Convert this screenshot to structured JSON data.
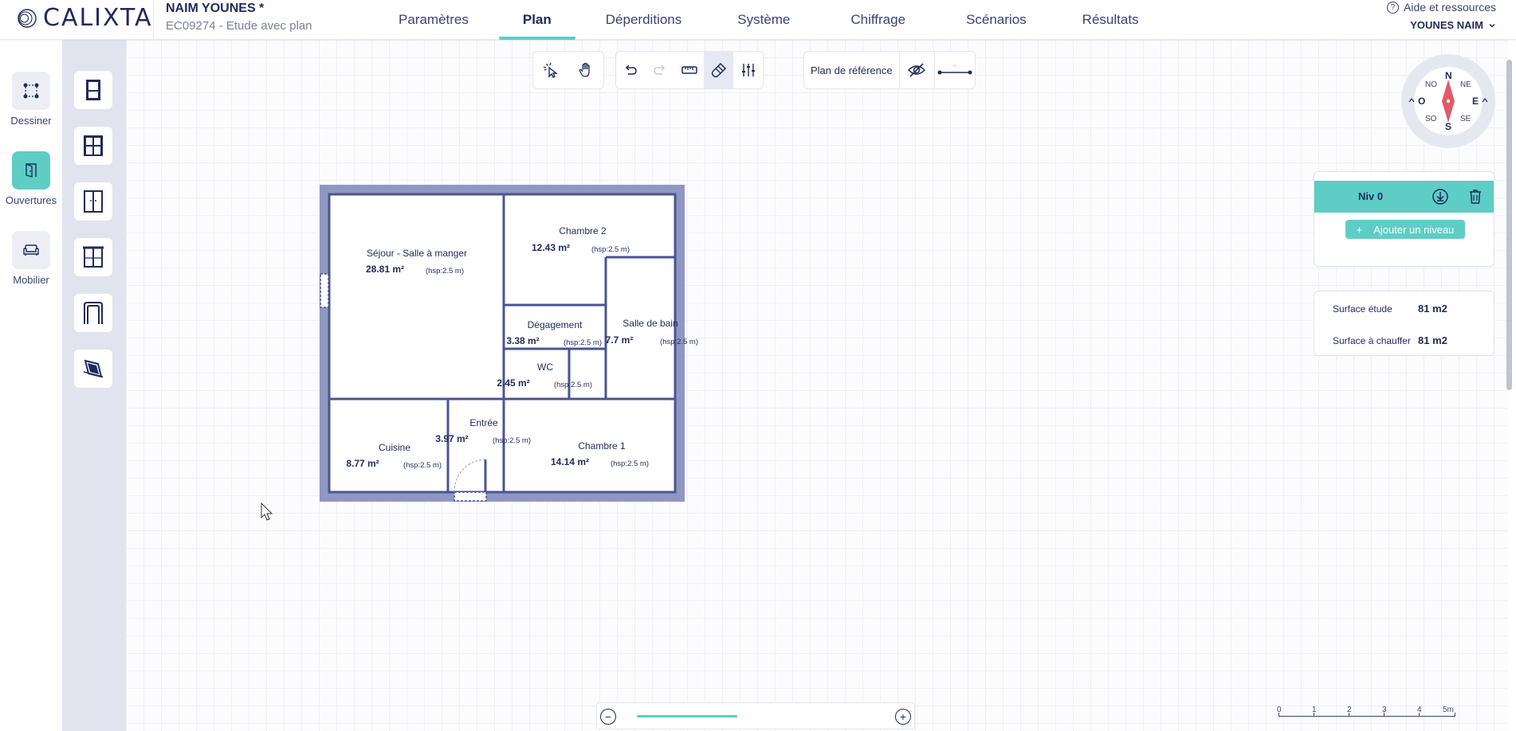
{
  "app": {
    "logo": "CALIXTA"
  },
  "project": {
    "name": "NAIM YOUNES *",
    "subtitle": "EC09274 - Etude avec plan"
  },
  "tabs": [
    {
      "label": "Paramètres"
    },
    {
      "label": "Plan",
      "active": true
    },
    {
      "label": "Déperditions"
    },
    {
      "label": "Système"
    },
    {
      "label": "Chiffrage"
    },
    {
      "label": "Scénarios"
    },
    {
      "label": "Résultats"
    }
  ],
  "header": {
    "help": "Aide et ressources",
    "user": "YOUNES NAIM"
  },
  "sidebar": {
    "items": [
      {
        "label": "Dessiner",
        "icon": "draw-shape-icon"
      },
      {
        "label": "Ouvertures",
        "icon": "door-icon",
        "active": true
      },
      {
        "label": "Mobilier",
        "icon": "sofa-icon"
      }
    ]
  },
  "tools": [
    "door-icon",
    "double-door-icon",
    "window-icon",
    "french-window-icon",
    "arch-opening-icon",
    "roof-window-icon"
  ],
  "toolbar": {
    "reference_plan": "Plan de référence",
    "scale_mark": "--"
  },
  "compass": {
    "N": "N",
    "S": "S",
    "E": "E",
    "O": "O",
    "NO": "NO",
    "NE": "NE",
    "SO": "SO",
    "SE": "SE"
  },
  "levels": {
    "current": "Niv 0",
    "add_label": "Ajouter un niveau",
    "add_symbol": "+"
  },
  "surfaces": [
    {
      "label": "Surface étude",
      "value": "81 m2"
    },
    {
      "label": "Surface à chauffer",
      "value": "81 m2"
    }
  ],
  "rooms": [
    {
      "name": "Séjour - Salle à manger",
      "area": "28.81 m²",
      "hsp": "(hsp:2.5 m)"
    },
    {
      "name": "Chambre 2",
      "area": "12.43 m²",
      "hsp": "(hsp:2.5 m)"
    },
    {
      "name": "Dégagement",
      "area": "3.38 m²",
      "hsp": "(hsp:2.5 m)"
    },
    {
      "name": "Salle de bain",
      "area": "7.7 m²",
      "hsp": "(hsp:2.5 m)"
    },
    {
      "name": "WC",
      "area": "2.45 m²",
      "hsp": "(hsp:2.5 m)"
    },
    {
      "name": "Entrée",
      "area": "3.97 m²",
      "hsp": "(hsp:2.5 m)"
    },
    {
      "name": "Cuisine",
      "area": "8.77 m²",
      "hsp": "(hsp:2.5 m)"
    },
    {
      "name": "Chambre 1",
      "area": "14.14 m²",
      "hsp": "(hsp:2.5 m)"
    }
  ],
  "zoom": {
    "minus": "−",
    "plus": "+"
  },
  "scale": {
    "labels": [
      "0",
      "1",
      "2",
      "3",
      "4",
      "5m"
    ]
  },
  "colors": {
    "accent": "#5ecdc5",
    "navy": "#1f2a5c",
    "wall": "#8f97c2",
    "wall_inner": "#4a5590"
  }
}
